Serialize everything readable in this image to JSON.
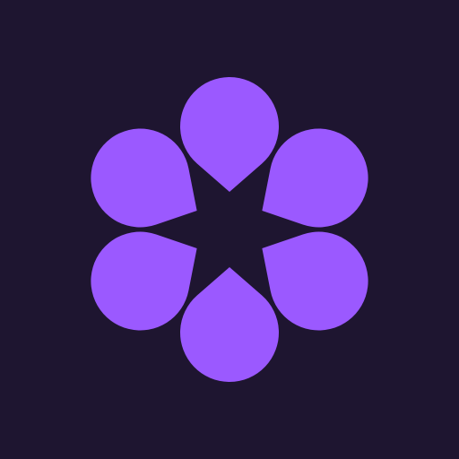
{
  "icon": {
    "name": "flower-logo-icon",
    "petal_count": 6,
    "colors": {
      "background": "#1E1530",
      "petal": "#9B59FF"
    }
  }
}
